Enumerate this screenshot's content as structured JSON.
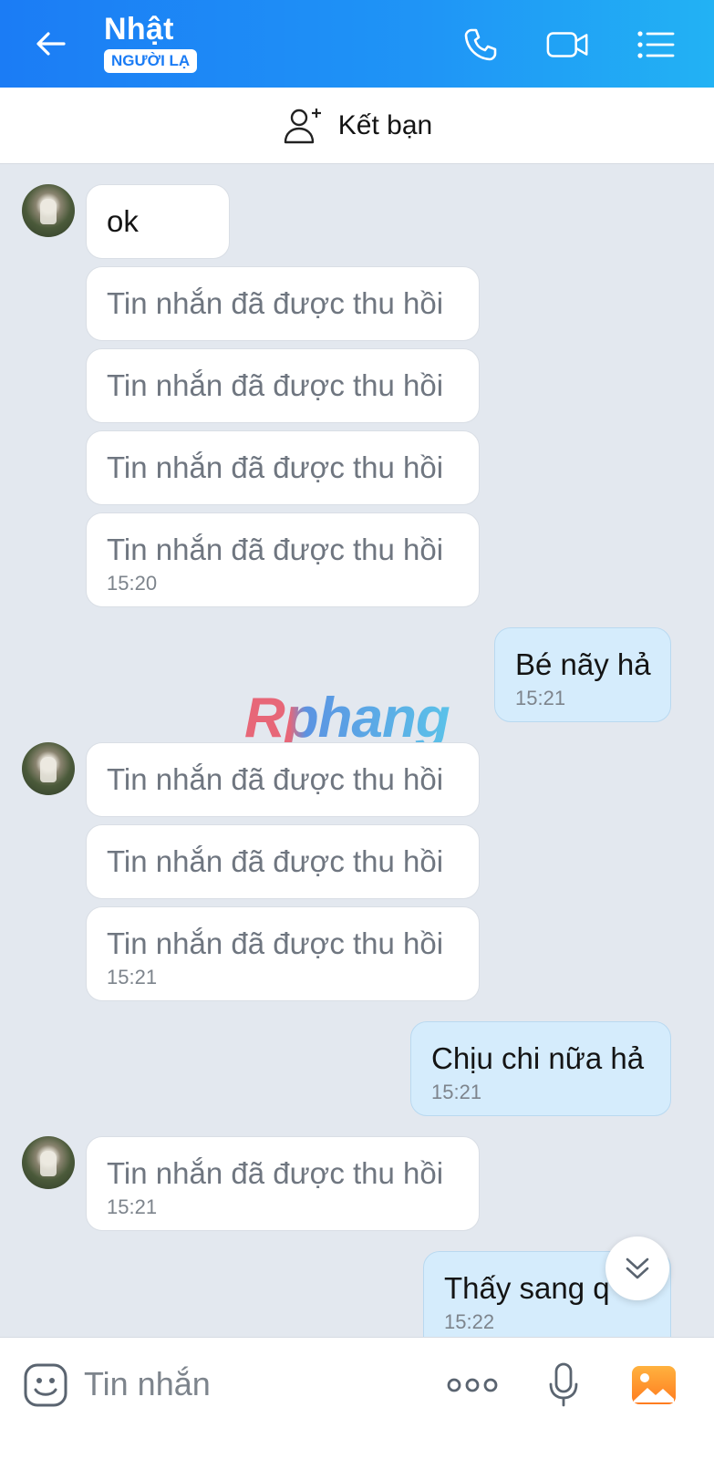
{
  "header": {
    "contact_name": "Nhật",
    "badge": "NGƯỜI LẠ",
    "icons": [
      "back-arrow-icon",
      "phone-icon",
      "video-call-icon",
      "menu-list-icon"
    ]
  },
  "friend_bar": {
    "label": "Kết bạn",
    "icon": "add-user-icon"
  },
  "watermark": "Rphang",
  "messages": [
    {
      "side": "them",
      "text": "ok"
    },
    {
      "side": "them",
      "text": "Tin nhắn đã được thu hồi"
    },
    {
      "side": "them",
      "text": "Tin nhắn đã được thu hồi"
    },
    {
      "side": "them",
      "text": "Tin nhắn đã được thu hồi"
    },
    {
      "side": "them",
      "text": "Tin nhắn đã được thu hồi",
      "time": "15:20"
    },
    {
      "side": "me",
      "text": "Bé nãy hả",
      "time": "15:21"
    },
    {
      "side": "them",
      "text": "Tin nhắn đã được thu hồi"
    },
    {
      "side": "them",
      "text": "Tin nhắn đã được thu hồi"
    },
    {
      "side": "them",
      "text": "Tin nhắn đã được thu hồi",
      "time": "15:21"
    },
    {
      "side": "me",
      "text": "Chịu chi nữa hả",
      "time": "15:21"
    },
    {
      "side": "them",
      "text": "Tin nhắn đã được thu hồi",
      "time": "15:21"
    },
    {
      "side": "me",
      "text": "Thấy sang q",
      "time": "15:22"
    }
  ],
  "input": {
    "placeholder": "Tin nhắn"
  },
  "colors": {
    "header_start": "#1b7cf5",
    "header_end": "#22b2f4",
    "my_bubble": "#d5ecfc",
    "chat_bg": "#e3e8ef"
  }
}
